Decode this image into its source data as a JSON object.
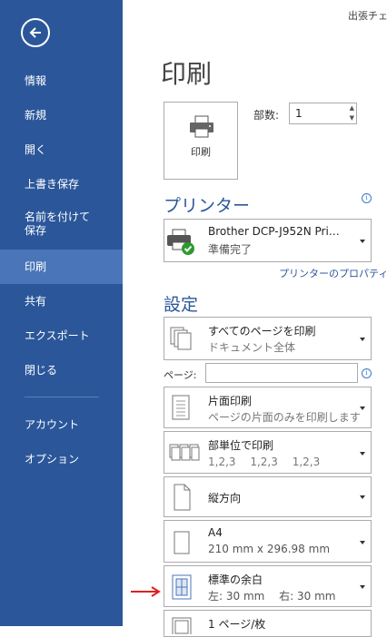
{
  "window": {
    "title": "出張チェッ"
  },
  "sidebar": {
    "items": [
      {
        "label": "情報"
      },
      {
        "label": "新規"
      },
      {
        "label": "開く"
      },
      {
        "label": "上書き保存"
      },
      {
        "label": "名前を付けて保存",
        "line1": "名前を付けて",
        "line2": "保存"
      },
      {
        "label": "印刷",
        "active": true
      },
      {
        "label": "共有"
      },
      {
        "label": "エクスポート"
      },
      {
        "label": "閉じる"
      },
      {
        "label": "アカウント"
      },
      {
        "label": "オプション"
      }
    ],
    "bg_color": "#2B579A",
    "active_color": "#4A76B9"
  },
  "main": {
    "title": "印刷",
    "print_button": {
      "label": "印刷",
      "icon": "printer-icon"
    },
    "copies": {
      "label": "部数:",
      "value": "1"
    },
    "printer_section": {
      "title": "プリンター",
      "printer": {
        "name": "Brother DCP-J952N Pri…",
        "status": "準備完了",
        "icon": "printer-ready-icon"
      },
      "properties_link": "プリンターのプロパティ"
    },
    "settings_section": {
      "title": "設定",
      "pages_label": "ページ:",
      "pages_value": "",
      "items": [
        {
          "line1": "すべてのページを印刷",
          "line2": "ドキュメント全体",
          "icon": "pages-icon"
        },
        {
          "line1": "片面印刷",
          "line2": "ページの片面のみを印刷します",
          "icon": "one-sided-icon"
        },
        {
          "line1": "部単位で印刷",
          "line2": "1,2,3　 1,2,3　 1,2,3",
          "icon": "collate-icon"
        },
        {
          "line1": "縦方向",
          "line2": "",
          "icon": "portrait-icon"
        },
        {
          "line1": "A4",
          "line2": "210 mm x 296.98 mm",
          "icon": "paper-size-icon"
        },
        {
          "line1": "標準の余白",
          "line2": "左: 30 mm　 右: 30 mm",
          "icon": "margins-icon"
        },
        {
          "line1": "1 ページ/枚",
          "line2": "",
          "icon": "pages-per-sheet-icon"
        }
      ]
    }
  },
  "annotation": {
    "icon": "red-arrow-icon",
    "color": "#E02020"
  }
}
